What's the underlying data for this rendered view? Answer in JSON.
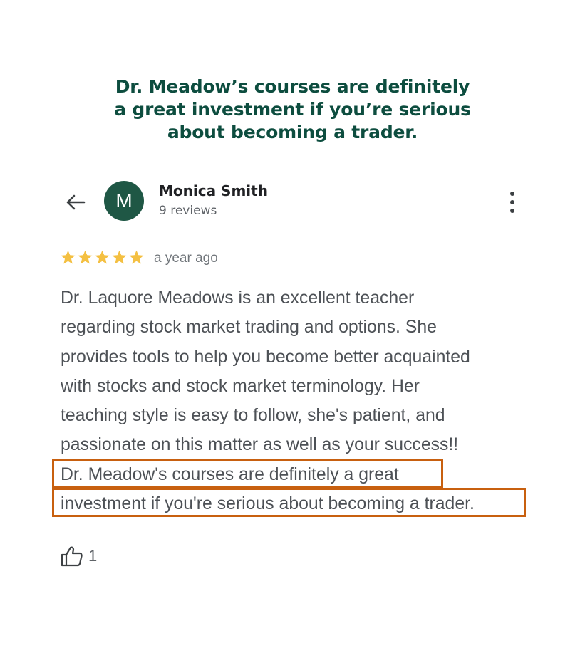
{
  "headline": {
    "lines": [
      "Dr. Meadow’s courses are definitely",
      "a great investment if you’re serious",
      "about becoming a trader."
    ]
  },
  "header": {
    "back_icon": "arrow-left-icon",
    "avatar_letter": "M",
    "avatar_color": "#1f5745",
    "reviewer_name": "Monica Smith",
    "review_count": "9 reviews",
    "menu_icon": "more-vertical-icon"
  },
  "review": {
    "rating": 5,
    "rating_max": 5,
    "star_color": "#f4c042",
    "date": "a year ago",
    "body_lines": [
      "Dr. Laquore Meadows is an excellent teacher",
      "regarding stock market trading and options. She",
      "provides tools to help you become better acquainted",
      "with stocks and stock market terminology. Her",
      "teaching style is easy to follow, she's patient, and",
      "passionate on this matter as well as your success!!",
      "Dr. Meadow's courses are definitely a great",
      "investment if you're serious about becoming a trader."
    ],
    "highlight_color": "#c8600f"
  },
  "footer": {
    "like_icon": "thumbs-up-icon",
    "like_count": "1"
  },
  "colors": {
    "headline": "#0d4d3f",
    "body_text": "#4d5156",
    "secondary_text": "#70757a"
  }
}
